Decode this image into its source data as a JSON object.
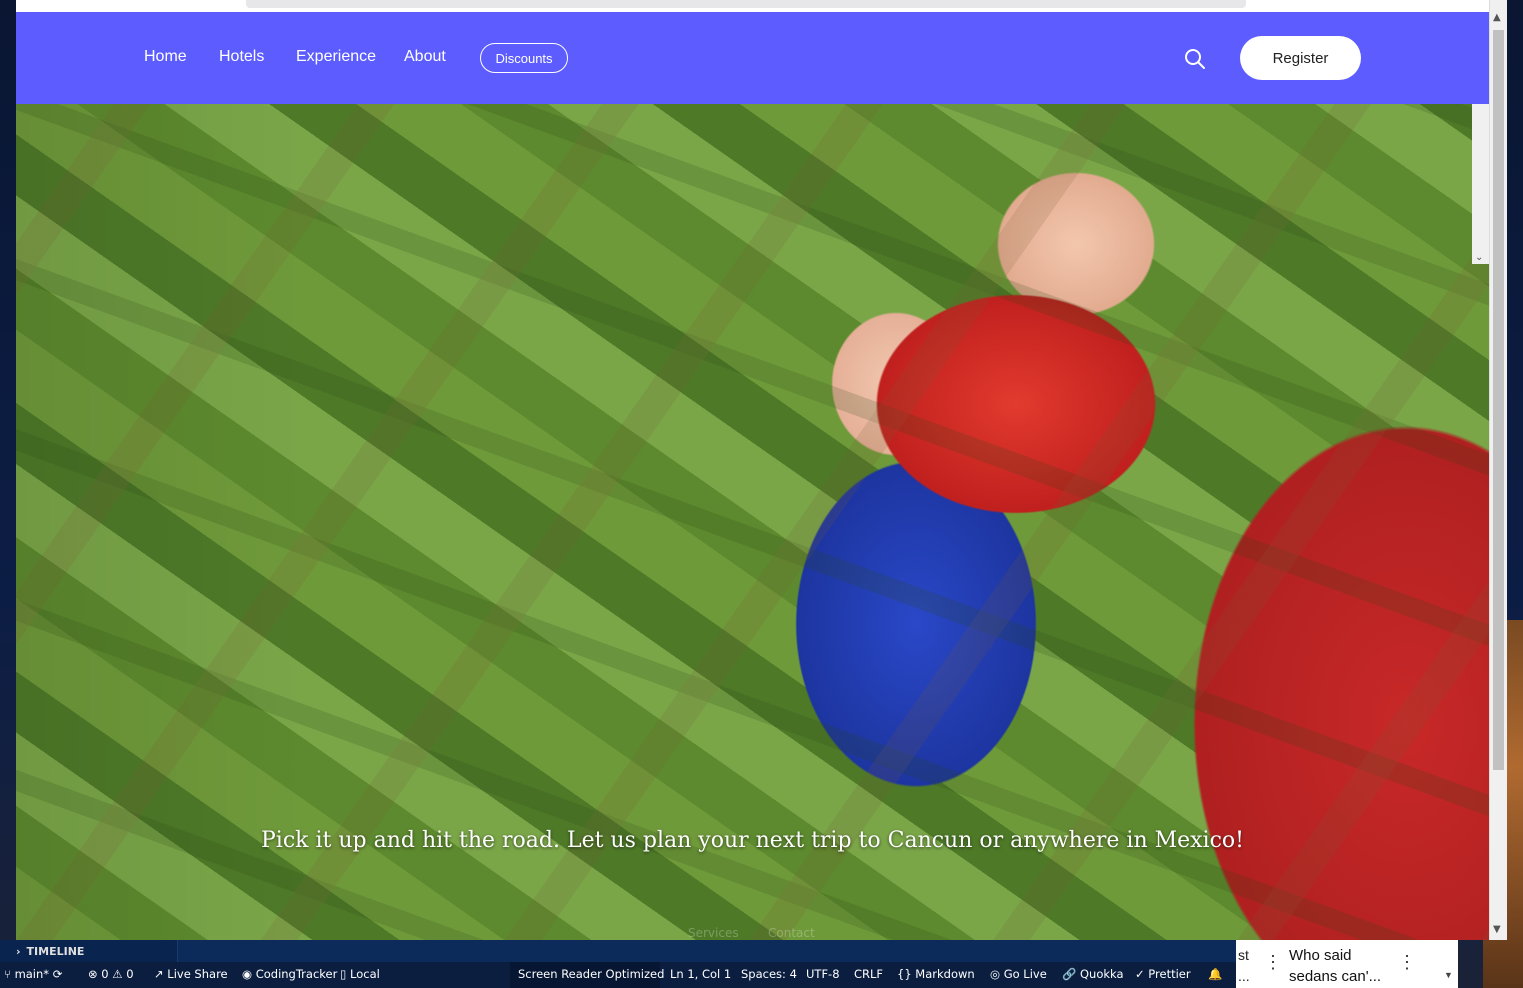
{
  "nav": {
    "links": [
      "Home",
      "Hotels",
      "Experience",
      "About"
    ],
    "discounts": "Discounts",
    "register": "Register"
  },
  "hero": {
    "caption": "Pick it up and hit the road. Let us plan your next trip to Cancun or anywhere in Mexico!",
    "footer_links": [
      "Services",
      "Contact"
    ]
  },
  "timeline": {
    "label": "TIMELINE"
  },
  "statusbar": {
    "branch": "main*",
    "errors": "0",
    "warnings": "0",
    "live_share": "Live Share",
    "coding_tracker": "CodingTracker",
    "local": "Local",
    "screen_reader": "Screen Reader Optimized",
    "position": "Ln 1, Col 1",
    "spaces": "Spaces: 4",
    "encoding": "UTF-8",
    "eol": "CRLF",
    "language": "Markdown",
    "go_live": "Go Live",
    "quokka": "Quokka",
    "prettier": "Prettier"
  },
  "news": {
    "left_fragment_1": "st",
    "left_fragment_2": "...",
    "title_line1": "Who said",
    "title_line2": "sedans can'..."
  },
  "colors": {
    "nav_bg": "#5c5cff",
    "status_bg": "#0b1e40"
  }
}
